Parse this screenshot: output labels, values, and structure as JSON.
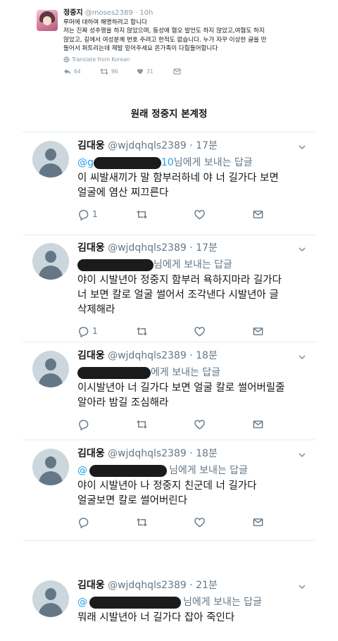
{
  "original": {
    "name": "정중지",
    "meta": "@moses2389 · 10h",
    "lines": [
      "루머에 대하여 해명하려고 합니다",
      "저는 진짜 성추행을 하지 않았으며, 동성애 혐오 발언도 하지 않았고,여혐도 하지",
      "않았고, 길에서 여성분께 번호 주려고 한적도 없습니다. 누가 자꾸 이상한 글을 만",
      "들어서 퍼트리는데 제발 믿어주세요 온가족이 다힘들어합니다"
    ],
    "translate": "Translate from Korean",
    "counts": {
      "reply": "64",
      "retweet": "96",
      "like": "31"
    }
  },
  "section_title": "원래 정중지 본계정",
  "replies": [
    {
      "name": "김대웅",
      "meta": "@wjdqhqls2389 · 17분",
      "mention_prefix": "@g",
      "mention_suffix": "10",
      "reply_label": "님에게 보내는 답글",
      "lines": [
        "이 씨발새끼가 말 함부러하네 야 너 길가다 보면",
        "얼굴에 염산 찌끄른다"
      ],
      "reply_count": "1"
    },
    {
      "name": "김대웅",
      "meta": "@wjdqhqls2389 · 17분",
      "mention_prefix": "",
      "mention_suffix": "",
      "reply_label": "님에게 보내는 답글",
      "lines": [
        "야이 시발년아 정중지 함부러 욕하지마라 길가다",
        "너 보면 칼로 얼굴 썰어서 조각낸다 시발년아 글",
        "삭제해라"
      ],
      "reply_count": "1"
    },
    {
      "name": "김대웅",
      "meta": "@wjdqhqls2389 · 18분",
      "mention_prefix": "",
      "mention_suffix": "",
      "reply_label": "에게 보내는 답글",
      "lines": [
        "이시발년아 너 길가다 보면 얼굴 칼로 썰어버릴줄",
        "알아라 밤길 조심해라"
      ],
      "reply_count": ""
    },
    {
      "name": "김대웅",
      "meta": "@wjdqhqls2389 · 18분",
      "mention_prefix": "@",
      "mention_suffix": "",
      "reply_label": "님에게 보내는 답글",
      "lines": [
        "야이 시발년아 나 정중지 친군데 너 길가다",
        "얼굴보면 칼로 썰어버린다"
      ],
      "reply_count": ""
    },
    {
      "name": "김대웅",
      "meta": "@wjdqhqls2389 · 21분",
      "mention_prefix": "@",
      "mention_suffix": "",
      "reply_label": "님에게 보내는 답글",
      "lines": [
        "뭐래 시발년아 너 길가다 잡아 죽인다"
      ],
      "reply_count": ""
    }
  ]
}
